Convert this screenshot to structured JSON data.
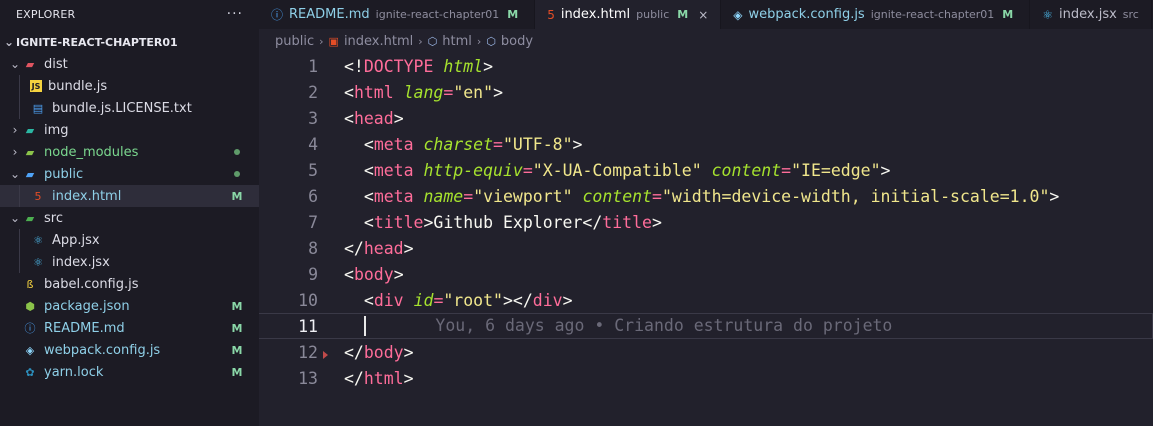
{
  "explorer": {
    "title": "EXPLORER",
    "more": "···",
    "project": "IGNITE-REACT-CHAPTER01",
    "items": [
      {
        "label": "dist",
        "type": "folder-open",
        "depth": 1,
        "icon": "folder-dist-icon",
        "color": "#e05561"
      },
      {
        "label": "bundle.js",
        "type": "file",
        "depth": 2,
        "icon": "js-file-icon",
        "color": "#f5d33f"
      },
      {
        "label": "bundle.js.LICENSE.txt",
        "type": "file",
        "depth": 2,
        "icon": "text-file-icon",
        "color": "#4c9ff0"
      },
      {
        "label": "img",
        "type": "folder-closed",
        "depth": 1,
        "icon": "folder-images-icon",
        "color": "#2bb7a3"
      },
      {
        "label": "node_modules",
        "type": "folder-closed",
        "depth": 1,
        "icon": "folder-node-icon",
        "color": "#8bc34a",
        "status": "dot",
        "labelClass": "green"
      },
      {
        "label": "public",
        "type": "folder-open",
        "depth": 1,
        "icon": "folder-public-icon",
        "color": "#4fa3f7",
        "status": "dot",
        "labelClass": "modified"
      },
      {
        "label": "index.html",
        "type": "file",
        "depth": 2,
        "icon": "html-file-icon",
        "color": "#e44d26",
        "badge": "M",
        "selected": true,
        "labelClass": "modified"
      },
      {
        "label": "src",
        "type": "folder-open",
        "depth": 1,
        "icon": "folder-src-icon",
        "color": "#4caf50"
      },
      {
        "label": "App.jsx",
        "type": "file",
        "depth": 2,
        "icon": "react-file-icon",
        "color": "#4fc3f7"
      },
      {
        "label": "index.jsx",
        "type": "file",
        "depth": 2,
        "icon": "react-file-icon",
        "color": "#4fc3f7"
      },
      {
        "label": "babel.config.js",
        "type": "file",
        "depth": 1,
        "icon": "babel-file-icon",
        "color": "#f5d33f"
      },
      {
        "label": "package.json",
        "type": "file",
        "depth": 1,
        "icon": "nodejs-file-icon",
        "color": "#8bc34a",
        "badge": "M",
        "labelClass": "modified"
      },
      {
        "label": "README.md",
        "type": "file",
        "depth": 1,
        "icon": "info-file-icon",
        "color": "#4c9ff0",
        "badge": "M",
        "labelClass": "modified"
      },
      {
        "label": "webpack.config.js",
        "type": "file",
        "depth": 1,
        "icon": "webpack-file-icon",
        "color": "#8ed6fb",
        "badge": "M",
        "labelClass": "modified"
      },
      {
        "label": "yarn.lock",
        "type": "file",
        "depth": 1,
        "icon": "yarn-file-icon",
        "color": "#2c8ebb",
        "badge": "M",
        "labelClass": "modified"
      }
    ]
  },
  "tabs": [
    {
      "label": "README.md",
      "desc": "ignite-react-chapter01",
      "badge": "M",
      "icon": "info-file-icon",
      "color": "#4c9ff0",
      "active": false
    },
    {
      "label": "index.html",
      "desc": "public",
      "badge": "M",
      "icon": "html-file-icon",
      "color": "#e44d26",
      "active": true,
      "close": "×"
    },
    {
      "label": "webpack.config.js",
      "desc": "ignite-react-chapter01",
      "badge": "M",
      "icon": "webpack-file-icon",
      "color": "#8ed6fb",
      "active": false
    },
    {
      "label": "index.jsx",
      "desc": "src",
      "badge": "",
      "icon": "react-file-icon",
      "color": "#4fc3f7",
      "active": false
    }
  ],
  "breadcrumb": [
    "public",
    "index.html",
    "html",
    "body"
  ],
  "editor": {
    "current_line": 11,
    "blame": "You, 6 days ago • Criando estrutura do projeto",
    "lines": [
      {
        "n": "1",
        "tokens": [
          [
            "pun",
            "<!"
          ],
          [
            "tag",
            "DOCTYPE"
          ],
          [
            "pun",
            " "
          ],
          [
            "attr",
            "html"
          ],
          [
            "pun",
            ">"
          ]
        ]
      },
      {
        "n": "2",
        "tokens": [
          [
            "pun",
            "<"
          ],
          [
            "tag",
            "html"
          ],
          [
            "pun",
            " "
          ],
          [
            "attr",
            "lang"
          ],
          [
            "tag",
            "="
          ],
          [
            "str",
            "\"en\""
          ],
          [
            "pun",
            ">"
          ]
        ]
      },
      {
        "n": "3",
        "tokens": [
          [
            "pun",
            "<"
          ],
          [
            "tag",
            "head"
          ],
          [
            "pun",
            ">"
          ]
        ]
      },
      {
        "n": "4",
        "tokens": [
          [
            "pun",
            "  <"
          ],
          [
            "tag",
            "meta"
          ],
          [
            "pun",
            " "
          ],
          [
            "attr",
            "charset"
          ],
          [
            "tag",
            "="
          ],
          [
            "str",
            "\"UTF-8\""
          ],
          [
            "pun",
            ">"
          ]
        ]
      },
      {
        "n": "5",
        "tokens": [
          [
            "pun",
            "  <"
          ],
          [
            "tag",
            "meta"
          ],
          [
            "pun",
            " "
          ],
          [
            "attr",
            "http-equiv"
          ],
          [
            "tag",
            "="
          ],
          [
            "str",
            "\"X-UA-Compatible\""
          ],
          [
            "pun",
            " "
          ],
          [
            "attr",
            "content"
          ],
          [
            "tag",
            "="
          ],
          [
            "str",
            "\"IE=edge\""
          ],
          [
            "pun",
            ">"
          ]
        ]
      },
      {
        "n": "6",
        "tokens": [
          [
            "pun",
            "  <"
          ],
          [
            "tag",
            "meta"
          ],
          [
            "pun",
            " "
          ],
          [
            "attr",
            "name"
          ],
          [
            "tag",
            "="
          ],
          [
            "str",
            "\"viewport\""
          ],
          [
            "pun",
            " "
          ],
          [
            "attr",
            "content"
          ],
          [
            "tag",
            "="
          ],
          [
            "str",
            "\"width=device-width, initial-scale=1.0\""
          ],
          [
            "pun",
            ">"
          ]
        ]
      },
      {
        "n": "7",
        "tokens": [
          [
            "pun",
            "  <"
          ],
          [
            "tag",
            "title"
          ],
          [
            "pun",
            ">Github Explorer</"
          ],
          [
            "tag",
            "title"
          ],
          [
            "pun",
            ">"
          ]
        ]
      },
      {
        "n": "8",
        "tokens": [
          [
            "pun",
            "</"
          ],
          [
            "tag",
            "head"
          ],
          [
            "pun",
            ">"
          ]
        ]
      },
      {
        "n": "9",
        "tokens": [
          [
            "pun",
            "<"
          ],
          [
            "tag",
            "body"
          ],
          [
            "pun",
            ">"
          ]
        ]
      },
      {
        "n": "10",
        "tokens": [
          [
            "pun",
            "  <"
          ],
          [
            "tag",
            "div"
          ],
          [
            "pun",
            " "
          ],
          [
            "attr",
            "id"
          ],
          [
            "tag",
            "="
          ],
          [
            "str",
            "\"root\""
          ],
          [
            "pun",
            "></"
          ],
          [
            "tag",
            "div"
          ],
          [
            "pun",
            ">"
          ]
        ]
      },
      {
        "n": "11",
        "tokens": []
      },
      {
        "n": "12",
        "tokens": [
          [
            "pun",
            "</"
          ],
          [
            "tag",
            "body"
          ],
          [
            "pun",
            ">"
          ]
        ]
      },
      {
        "n": "13",
        "tokens": [
          [
            "pun",
            "</"
          ],
          [
            "tag",
            "html"
          ],
          [
            "pun",
            ">"
          ]
        ]
      }
    ]
  }
}
